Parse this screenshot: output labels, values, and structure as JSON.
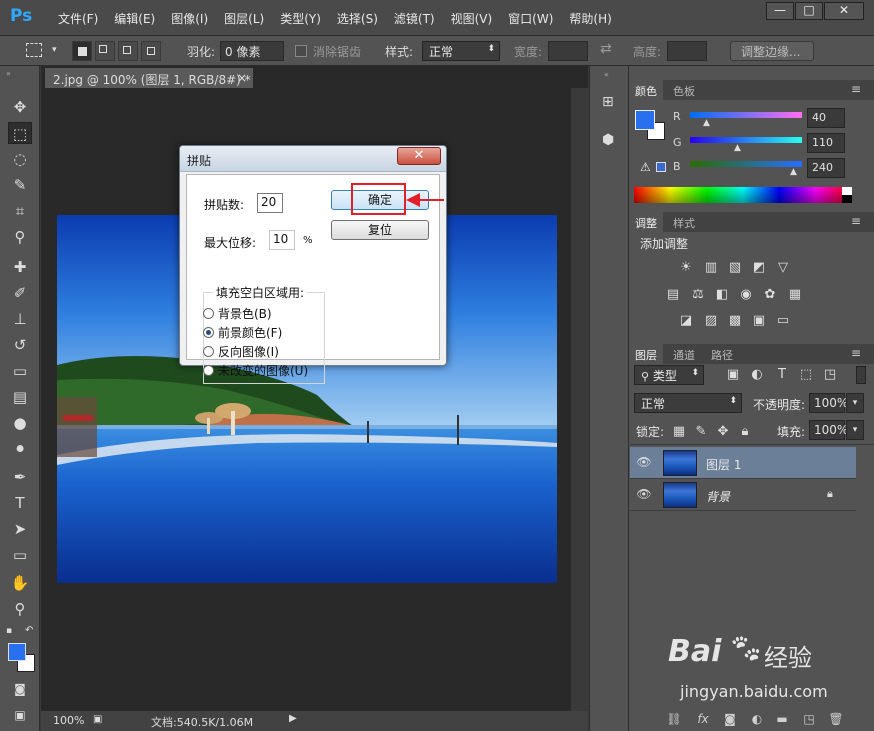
{
  "app": {
    "logo": "Ps"
  },
  "menu": [
    "文件(F)",
    "编辑(E)",
    "图像(I)",
    "图层(L)",
    "类型(Y)",
    "选择(S)",
    "滤镜(T)",
    "视图(V)",
    "窗口(W)",
    "帮助(H)"
  ],
  "window_controls": {
    "minimize": "—",
    "restore": "□",
    "close": "✕"
  },
  "options": {
    "feather_label": "羽化:",
    "feather_value": "0 像素",
    "antialias_label": "消除锯齿",
    "style_label": "样式:",
    "style_value": "正常",
    "width_label": "宽度:",
    "height_label": "高度:",
    "refine_edge": "调整边缘..."
  },
  "document": {
    "tab_title": "2.jpg @ 100% (图层 1, RGB/8#) *",
    "tab_close": "×",
    "zoom": "100%",
    "doc_info": "文档:540.5K/1.06M"
  },
  "dialog": {
    "title": "拼贴",
    "close": "✕",
    "tiles_label": "拼贴数:",
    "tiles_value": "20",
    "offset_label": "最大位移:",
    "offset_value": "10",
    "offset_unit": "%",
    "ok": "确定",
    "reset": "复位",
    "fill_group_title": "填充空白区域用:",
    "fill_options": [
      "背景色(B)",
      "前景颜色(F)",
      "反向图像(I)",
      "未改变的图像(U)"
    ],
    "fill_selected_index": 1
  },
  "color_panel": {
    "tabs": [
      "颜色",
      "色板"
    ],
    "active_tab": 0,
    "channels": [
      {
        "label": "R",
        "value": "40"
      },
      {
        "label": "G",
        "value": "110"
      },
      {
        "label": "B",
        "value": "240"
      }
    ],
    "foreground_color": "#2870f0",
    "background_color": "#ffffff"
  },
  "adjustments_panel": {
    "tabs": [
      "调整",
      "样式"
    ],
    "active_tab": 0,
    "heading": "添加调整"
  },
  "layers_panel": {
    "tabs": [
      "图层",
      "通道",
      "路径"
    ],
    "active_tab": 0,
    "filter_label": "类型",
    "blend_mode": "正常",
    "opacity_label": "不透明度:",
    "opacity_value": "100%",
    "lock_label": "锁定:",
    "fill_label": "填充:",
    "fill_value": "100%",
    "layers": [
      {
        "name": "图层 1",
        "selected": true,
        "locked": false
      },
      {
        "name": "背景",
        "selected": false,
        "locked": true
      }
    ]
  },
  "watermark": {
    "brand": "Bai",
    "brand2": "经验",
    "url": "jingyan.baidu.com"
  }
}
